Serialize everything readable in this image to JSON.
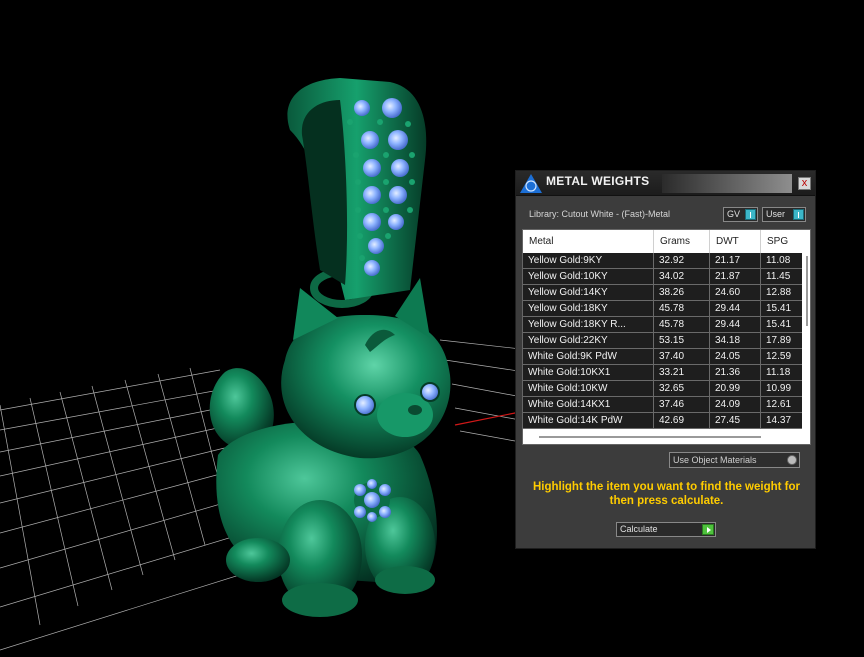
{
  "window": {
    "title": "METAL WEIGHTS",
    "close_label": "x"
  },
  "library": "Library: Cutout White - (Fast)-Metal",
  "gv_label": "GV",
  "user_label": "User",
  "table": {
    "columns": [
      "Metal",
      "Grams",
      "DWT",
      "SPG"
    ],
    "rows": [
      [
        "Yellow Gold:9KY",
        "32.92",
        "21.17",
        "11.08"
      ],
      [
        "Yellow Gold:10KY",
        "34.02",
        "21.87",
        "11.45"
      ],
      [
        "Yellow Gold:14KY",
        "38.26",
        "24.60",
        "12.88"
      ],
      [
        "Yellow Gold:18KY",
        "45.78",
        "29.44",
        "15.41"
      ],
      [
        "Yellow Gold:18KY R...",
        "45.78",
        "29.44",
        "15.41"
      ],
      [
        "Yellow Gold:22KY",
        "53.15",
        "34.18",
        "17.89"
      ],
      [
        "White Gold:9K PdW",
        "37.40",
        "24.05",
        "12.59"
      ],
      [
        "White Gold:10KX1",
        "33.21",
        "21.36",
        "11.18"
      ],
      [
        "White Gold:10KW",
        "32.65",
        "20.99",
        "10.99"
      ],
      [
        "White Gold:14KX1",
        "37.46",
        "24.09",
        "12.61"
      ],
      [
        "White Gold:14K PdW",
        "42.69",
        "27.45",
        "14.37"
      ]
    ]
  },
  "use_object_materials": "Use Object Materials",
  "hint": "Highlight the item you want to find the weight for then press calculate.",
  "calculate_label": "Calculate",
  "colors": {
    "model_green": "#0f6e49",
    "gem_blue": "#7fa8ff",
    "hint_yellow": "#ffcc00",
    "grid": "#d8d8d8",
    "axis_red": "#d01818"
  },
  "icons": {
    "logo": "rhino-logo-icon",
    "close": "close-icon",
    "toggle": "toggle-knob-icon",
    "calculate": "play-arrow-icon"
  }
}
